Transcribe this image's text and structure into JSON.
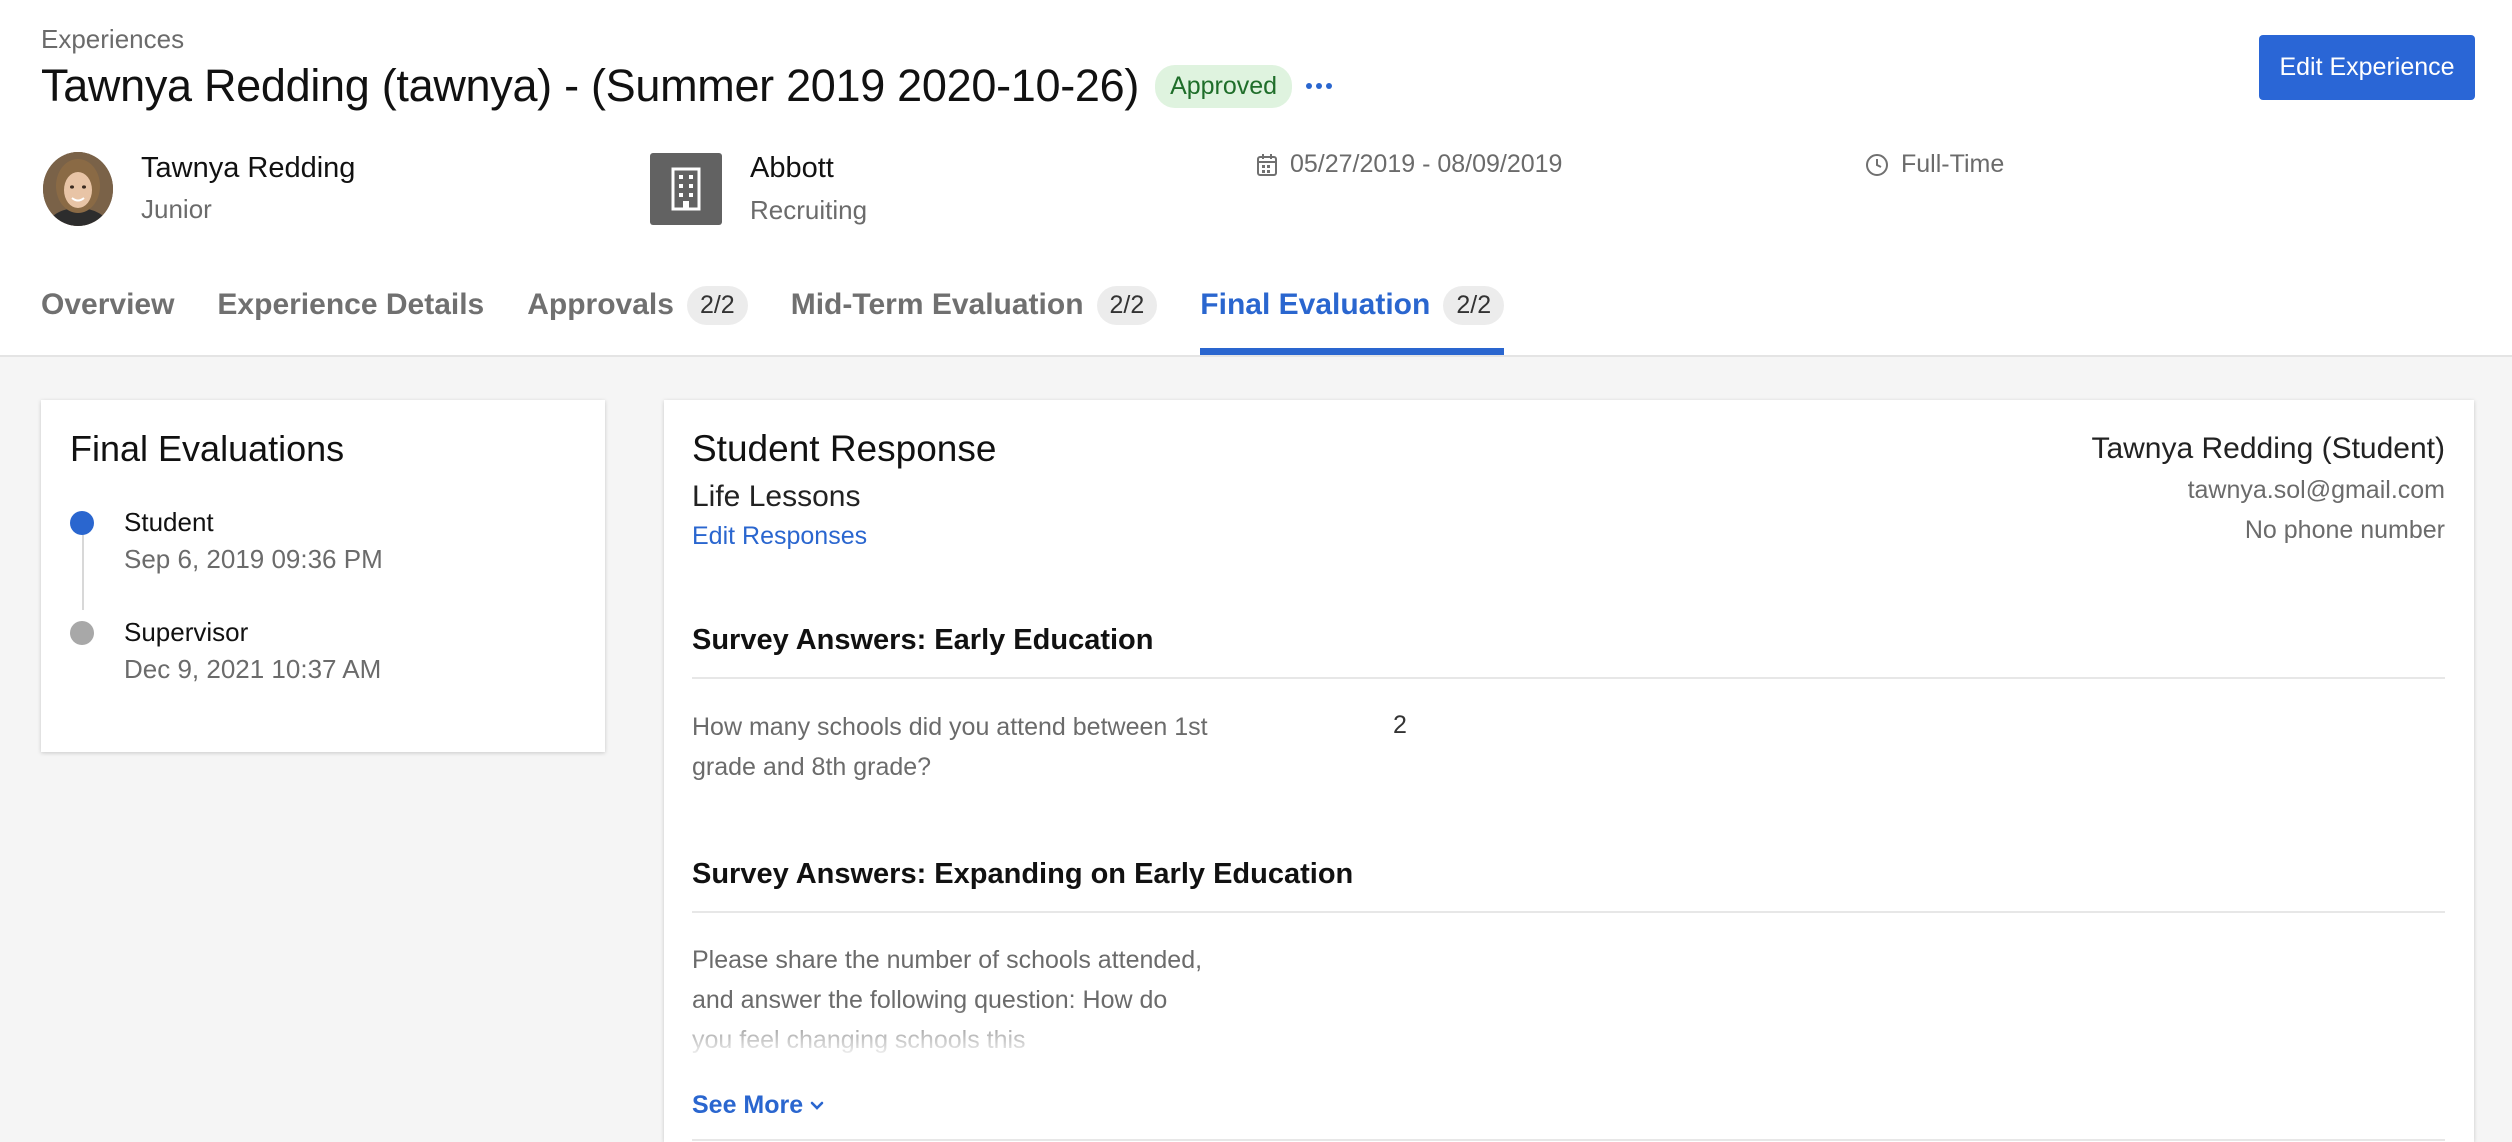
{
  "header": {
    "breadcrumb": "Experiences",
    "title": "Tawnya Redding (tawnya) - (Summer 2019 2020-10-26)",
    "status_badge": "Approved",
    "edit_button": "Edit Experience",
    "student": {
      "name": "Tawnya Redding",
      "year": "Junior"
    },
    "employer": {
      "name": "Abbott",
      "department": "Recruiting"
    },
    "dates": "05/27/2019 - 08/09/2019",
    "employment_type": "Full-Time"
  },
  "tabs": [
    {
      "label": "Overview",
      "count": null,
      "active": false
    },
    {
      "label": "Experience Details",
      "count": null,
      "active": false
    },
    {
      "label": "Approvals",
      "count": "2/2",
      "active": false
    },
    {
      "label": "Mid-Term Evaluation",
      "count": "2/2",
      "active": false
    },
    {
      "label": "Final Evaluation",
      "count": "2/2",
      "active": true
    }
  ],
  "final_evaluations": {
    "title": "Final Evaluations",
    "items": [
      {
        "role": "Student",
        "date": "Sep 6, 2019 09:36 PM",
        "status_color": "#2a66cf"
      },
      {
        "role": "Supervisor",
        "date": "Dec 9, 2021 10:37 AM",
        "status_color": "#a8a8a8"
      }
    ]
  },
  "response": {
    "title": "Student Response",
    "subtitle": "Life Lessons",
    "edit_link": "Edit Responses",
    "contact": {
      "name": "Tawnya Redding (Student)",
      "email": "tawnya.sol@gmail.com",
      "phone": "No phone number"
    },
    "sections": [
      {
        "title": "Survey Answers: Early Education",
        "question": "How many schools did you attend between 1st grade and 8th grade?",
        "answer": "2"
      },
      {
        "title": "Survey Answers: Expanding on Early Education",
        "question": "Please share the number of schools attended, and answer the following question: How do you feel changing schools this",
        "answer": ""
      }
    ],
    "see_more": "See More"
  },
  "colors": {
    "accent": "#2a66cf",
    "approved_bg": "#dff3df",
    "approved_text": "#1f6e2a"
  }
}
